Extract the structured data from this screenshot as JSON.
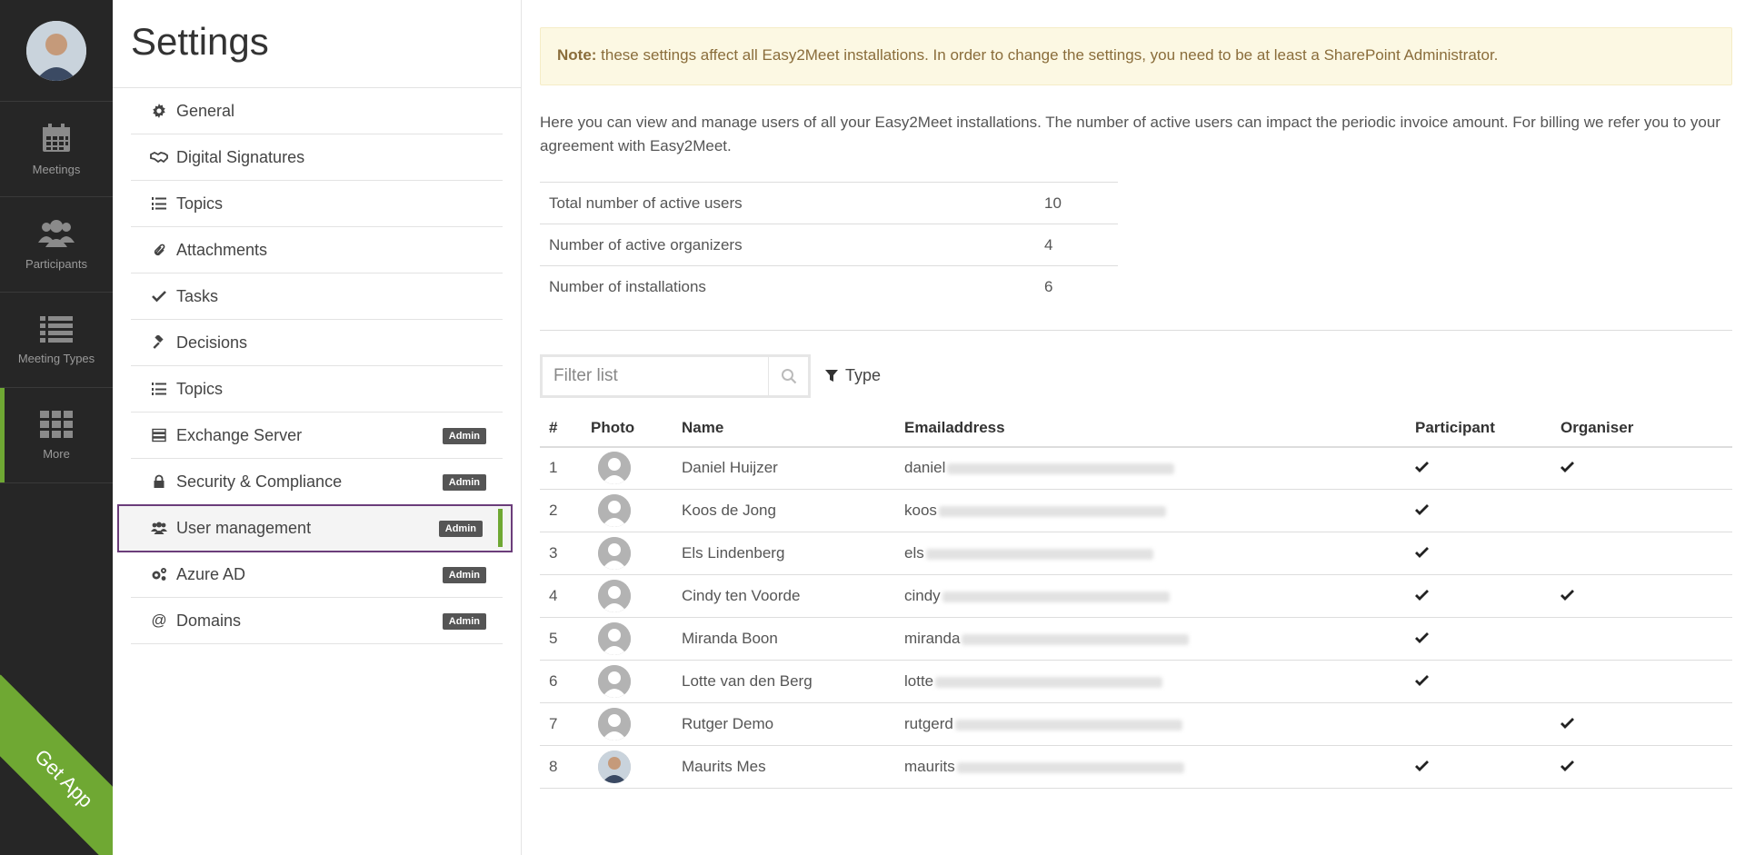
{
  "rail": {
    "items": [
      {
        "label": "Meetings",
        "icon": "calendar-icon"
      },
      {
        "label": "Participants",
        "icon": "users-icon"
      },
      {
        "label": "Meeting Types",
        "icon": "list-icon"
      },
      {
        "label": "More",
        "icon": "grid-icon",
        "active": true
      }
    ],
    "get_app_label": "Get App",
    "accent_color": "#6fa833"
  },
  "settings": {
    "title": "Settings",
    "items": [
      {
        "label": "General",
        "icon": "gear-icon",
        "badge": ""
      },
      {
        "label": "Digital Signatures",
        "icon": "handshake-icon",
        "badge": ""
      },
      {
        "label": "Topics",
        "icon": "list-ordered-icon",
        "badge": ""
      },
      {
        "label": "Attachments",
        "icon": "paperclip-icon",
        "badge": ""
      },
      {
        "label": "Tasks",
        "icon": "check-icon",
        "badge": ""
      },
      {
        "label": "Decisions",
        "icon": "gavel-icon",
        "badge": ""
      },
      {
        "label": "Topics",
        "icon": "list-ordered-icon",
        "badge": ""
      },
      {
        "label": "Exchange Server",
        "icon": "server-icon",
        "badge": "Admin"
      },
      {
        "label": "Security & Compliance",
        "icon": "lock-icon",
        "badge": "Admin"
      },
      {
        "label": "User management",
        "icon": "users-icon",
        "badge": "Admin",
        "selected": true
      },
      {
        "label": "Azure AD",
        "icon": "cogs-icon",
        "badge": "Admin"
      },
      {
        "label": "Domains",
        "icon": "at-icon",
        "badge": "Admin"
      }
    ]
  },
  "note": {
    "strong": "Note:",
    "text": " these settings affect all Easy2Meet installations. In order to change the settings, you need to be at least a SharePoint Administrator."
  },
  "intro": "Here you can view and manage users of all your Easy2Meet installations. The number of active users can impact the periodic invoice amount. For billing we refer you to your agreement with Easy2Meet.",
  "stats": [
    {
      "label": "Total number of active users",
      "value": "10"
    },
    {
      "label": "Number of active organizers",
      "value": "4"
    },
    {
      "label": "Number of installations",
      "value": "6"
    }
  ],
  "filter": {
    "placeholder": "Filter list",
    "type_label": "Type"
  },
  "table": {
    "headers": {
      "num": "#",
      "photo": "Photo",
      "name": "Name",
      "email": "Emailaddress",
      "participant": "Participant",
      "organiser": "Organiser"
    },
    "rows": [
      {
        "num": "1",
        "name": "Daniel Huijzer",
        "email": "daniel",
        "participant": true,
        "organiser": true,
        "has_photo": false
      },
      {
        "num": "2",
        "name": "Koos de Jong",
        "email": "koos",
        "participant": true,
        "organiser": false,
        "has_photo": false
      },
      {
        "num": "3",
        "name": "Els Lindenberg",
        "email": "els",
        "participant": true,
        "organiser": false,
        "has_photo": false
      },
      {
        "num": "4",
        "name": "Cindy ten Voorde",
        "email": "cindy",
        "participant": true,
        "organiser": true,
        "has_photo": false
      },
      {
        "num": "5",
        "name": "Miranda Boon",
        "email": "miranda",
        "participant": true,
        "organiser": false,
        "has_photo": false
      },
      {
        "num": "6",
        "name": "Lotte van den Berg",
        "email": "lotte",
        "participant": true,
        "organiser": false,
        "has_photo": false
      },
      {
        "num": "7",
        "name": "Rutger Demo",
        "email": "rutgerd",
        "participant": false,
        "organiser": true,
        "has_photo": false
      },
      {
        "num": "8",
        "name": "Maurits Mes",
        "email": "maurits",
        "participant": true,
        "organiser": true,
        "has_photo": true
      }
    ]
  }
}
